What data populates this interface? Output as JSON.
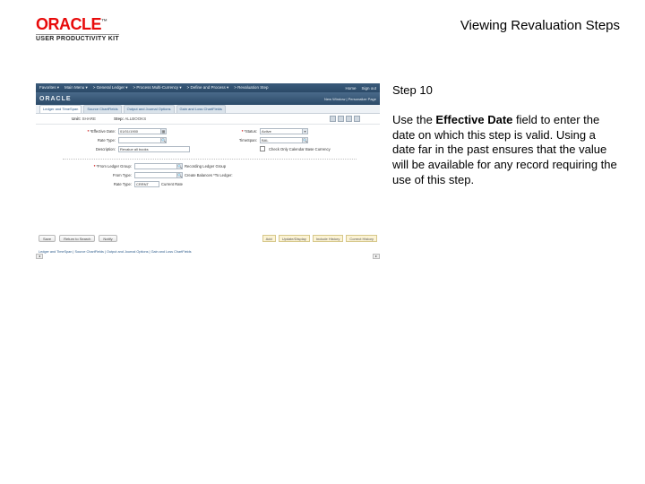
{
  "header": {
    "brand_main": "ORACLE",
    "brand_tm": "™",
    "brand_sub": "USER PRODUCTIVITY KIT",
    "doc_title": "Viewing Revaluation Steps"
  },
  "panel": {
    "step_label": "Step 10",
    "body_prefix": "Use the ",
    "body_bold": "Effective Date",
    "body_suffix": " field to enter the date on which this step is valid. Using a date far in the past ensures that the value will be available for any record requiring the use of this step."
  },
  "ss": {
    "topbar_left": [
      "Favorites ▾",
      "Main Menu ▾",
      "> General Ledger ▾",
      "> Process Multi-Currency ▾",
      "> Define and Process ▾",
      "> Revaluation Step"
    ],
    "topbar_right": [
      "Home",
      "Sign out"
    ],
    "brand": "ORACLE",
    "bread": "New Window | Personalize Page",
    "tabs": [
      "Ledger and TimeSpan",
      "Source ChartFields",
      "Output and Journal Options",
      "Gain and Loss ChartFields"
    ],
    "row1": {
      "unit_lbl": "Unit:",
      "unit_val": "SHARE",
      "step_lbl": "Step:",
      "step_val": "ALLBOOKS"
    },
    "form_left": [
      {
        "lbl": "*Effective Date:",
        "val": "01/01/1900",
        "req": true,
        "lookup": true
      },
      {
        "lbl": "Rate Type:",
        "val": "",
        "lookup": true
      },
      {
        "lbl": "Description:",
        "val": "Revalue all books",
        "wide": true
      }
    ],
    "form_right": [
      {
        "lbl": "*Status:",
        "val": "Active",
        "select": true
      },
      {
        "lbl": "TimeSpan:",
        "val": "BAL",
        "lookup": true
      },
      {
        "lbl": "",
        "chk": true,
        "val": "Check Only Calendar Base Currency"
      }
    ],
    "sub_rows": [
      {
        "lbl": "*From Ledger Group:",
        "val": "",
        "ftext": "Recording   Ledger Group",
        "lookup": true
      },
      {
        "lbl": "From Type:",
        "val": "",
        "ftext": "Create Balances  *To Ledger:",
        "lookup": true
      },
      {
        "lbl": "Rate Type:",
        "val": "CRRNT",
        "ftext": "Current Rate",
        "lookup": true
      }
    ],
    "buttons": [
      "Save",
      "Return to Search",
      "Notify"
    ],
    "slots": [
      "Add",
      "Update/Display",
      "Include History",
      "Correct History"
    ],
    "footer_links": "Ledger and TimeSpan | Source ChartFields | Output and Journal Options | Gain and Loss ChartFields"
  }
}
